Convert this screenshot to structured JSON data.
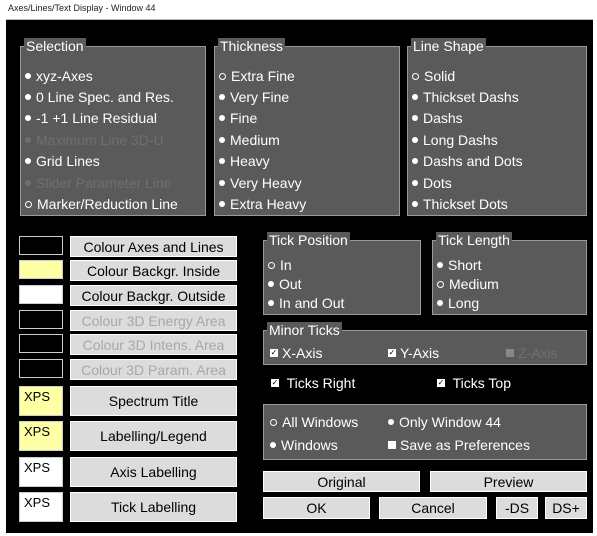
{
  "window": {
    "title": "Axes/Lines/Text Display - Window 44"
  },
  "selection": {
    "title": "Selection",
    "items": [
      {
        "label": "xyz-Axes",
        "enabled": true,
        "selected": false
      },
      {
        "label": "0 Line Spec. and Res.",
        "enabled": true,
        "selected": false
      },
      {
        "label": "-1 +1 Line Residual",
        "enabled": true,
        "selected": false
      },
      {
        "label": "Maximum Line 3D-U",
        "enabled": false,
        "selected": false
      },
      {
        "label": "Grid Lines",
        "enabled": true,
        "selected": false
      },
      {
        "label": "Slider Parameter Line",
        "enabled": false,
        "selected": false
      },
      {
        "label": "Marker/Reduction Line",
        "enabled": true,
        "selected": true
      }
    ]
  },
  "thickness": {
    "title": "Thickness",
    "items": [
      "Extra Fine",
      "Very Fine",
      "Fine",
      "Medium",
      "Heavy",
      "Very Heavy",
      "Extra Heavy"
    ],
    "selected": "Extra Fine"
  },
  "line_shape": {
    "title": "Line Shape",
    "items": [
      "Solid",
      "Thickset Dashs",
      "Dashs",
      "Long Dashs",
      "Dashs and Dots",
      "Dots",
      "Thickset Dots"
    ],
    "selected": "Solid"
  },
  "colour_buttons": [
    {
      "label": "Colour Axes and Lines",
      "swatch": "#000000",
      "enabled": true
    },
    {
      "label": "Colour Backgr. Inside",
      "swatch": "#ffffa6",
      "enabled": true
    },
    {
      "label": "Colour Backgr. Outside",
      "swatch": "#ffffff",
      "enabled": true
    },
    {
      "label": "Colour 3D Energy Area",
      "swatch": "#000000",
      "enabled": false
    },
    {
      "label": "Colour 3D Intens. Area",
      "swatch": "#000000",
      "enabled": false
    },
    {
      "label": "Colour 3D Param. Area",
      "swatch": "#000000",
      "enabled": false
    }
  ],
  "label_buttons": [
    {
      "label": "Spectrum Title",
      "swatch_text": "XPS",
      "swatch": "#ffffa6"
    },
    {
      "label": "Labelling/Legend",
      "swatch_text": "XPS",
      "swatch": "#ffffa6"
    },
    {
      "label": "Axis Labelling",
      "swatch_text": "XPS",
      "swatch": "#ffffff"
    },
    {
      "label": "Tick Labelling",
      "swatch_text": "XPS",
      "swatch": "#ffffff"
    }
  ],
  "tick_position": {
    "title": "Tick Position",
    "items": [
      "In",
      "Out",
      "In and Out"
    ],
    "selected": "In"
  },
  "tick_length": {
    "title": "Tick Length",
    "items": [
      "Short",
      "Medium",
      "Long"
    ],
    "selected": "Medium"
  },
  "minor_ticks": {
    "title": "Minor Ticks",
    "x_axis": "X-Axis",
    "y_axis": "Y-Axis",
    "z_axis": "Z-Axis"
  },
  "ticks_right": "Ticks Right",
  "ticks_top": "Ticks Top",
  "scope": {
    "all_windows": "All Windows",
    "only_window": "Only Window  44",
    "windows": "Windows",
    "save_prefs": "Save as Preferences"
  },
  "buttons": {
    "original": "Original",
    "preview": "Preview",
    "ok": "OK",
    "cancel": "Cancel",
    "ds_minus": "-DS",
    "ds_plus": "DS+"
  },
  "colors": {
    "panel": "#5a5a5a",
    "background": "#000000",
    "button": "#dcdcdc",
    "yellow_swatch": "#ffffa6"
  }
}
